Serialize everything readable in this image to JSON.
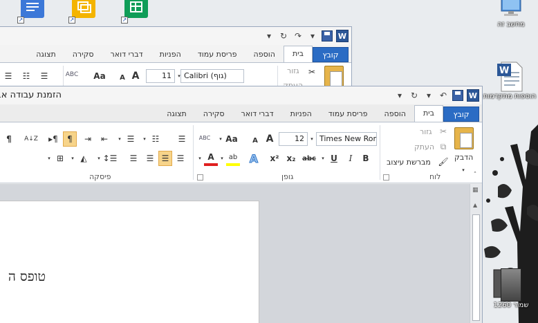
{
  "desktop": {
    "icons": [
      {
        "label": "מחשב זה",
        "name": "computer-icon"
      },
      {
        "label": "הוספות מתקדמות",
        "name": "word-document-icon"
      },
      {
        "label": "שמור 1260",
        "name": "image-file-icon"
      }
    ]
  },
  "back_window": {
    "tabs": [
      "קובץ",
      "בית",
      "הוספה",
      "פריסת עמוד",
      "הפניות",
      "דברי דואר",
      "סקירה",
      "תצוגה"
    ],
    "font_name": "Calibri (גוף)",
    "font_size": "11",
    "cut_label": "גזור",
    "copy_label": "העתק"
  },
  "front_window": {
    "title": "הזמנת עבודה אב",
    "tabs": [
      "קובץ",
      "בית",
      "הוספה",
      "פריסת עמוד",
      "הפניות",
      "דברי דואר",
      "סקירה",
      "תצוגה"
    ],
    "active_tab": "בית",
    "clipboard": {
      "paste_label": "הדבק",
      "cut_label": "גזור",
      "copy_label": "העתק",
      "format_painter_label": "מברשת עיצוב",
      "group_label": "לוח"
    },
    "font": {
      "font_name": "Times New Roma",
      "font_size": "12",
      "group_label": "גופן",
      "grow": "A",
      "shrink": "A",
      "change_case": "Aa",
      "clear": "ABC",
      "bold": "B",
      "italic": "I",
      "underline": "U",
      "strike": "abc",
      "subscript": "x₂",
      "superscript": "x²",
      "color_letter": "A",
      "highlight": "ab",
      "effects": "A"
    },
    "paragraph": {
      "group_label": "פיסקה",
      "pilcrow": "¶",
      "sort": "A↓Z"
    },
    "document": {
      "visible_text": "טופס ה"
    }
  }
}
